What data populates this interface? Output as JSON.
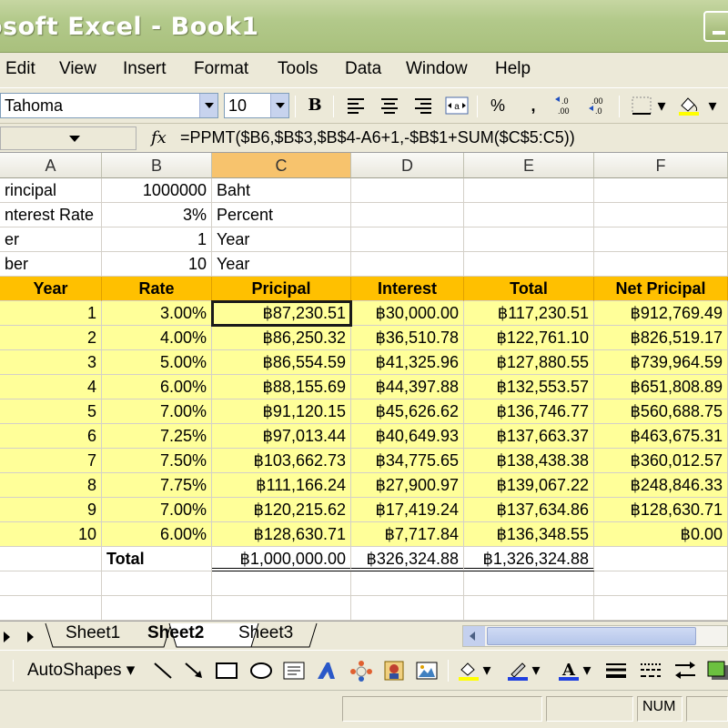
{
  "window": {
    "title": "osoft Excel - Book1"
  },
  "menu": [
    "Edit",
    "View",
    "Insert",
    "Format",
    "Tools",
    "Data",
    "Window",
    "Help"
  ],
  "format_toolbar": {
    "font_name": "Tahoma",
    "font_size": "10",
    "bold": "B",
    "percent": "%",
    "comma": ","
  },
  "formula_bar": {
    "fx": "fx",
    "formula": "=PPMT($B6,$B$3,$B$4-A6+1,-$B$1+SUM($C$5:C5))"
  },
  "columns": [
    "A",
    "B",
    "C",
    "D",
    "E",
    "F"
  ],
  "params": [
    [
      "rincipal",
      "1000000",
      "Baht"
    ],
    [
      "nterest Rate",
      "3%",
      "Percent"
    ],
    [
      "er",
      "1",
      "Year"
    ],
    [
      "ber",
      "10",
      "Year"
    ]
  ],
  "table": {
    "headers": [
      "Year",
      "Rate",
      "Pricipal",
      "Interest",
      "Total",
      "Net Pricipal"
    ],
    "rows": [
      [
        "1",
        "3.00%",
        "฿87,230.51",
        "฿30,000.00",
        "฿117,230.51",
        "฿912,769.49"
      ],
      [
        "2",
        "4.00%",
        "฿86,250.32",
        "฿36,510.78",
        "฿122,761.10",
        "฿826,519.17"
      ],
      [
        "3",
        "5.00%",
        "฿86,554.59",
        "฿41,325.96",
        "฿127,880.55",
        "฿739,964.59"
      ],
      [
        "4",
        "6.00%",
        "฿88,155.69",
        "฿44,397.88",
        "฿132,553.57",
        "฿651,808.89"
      ],
      [
        "5",
        "7.00%",
        "฿91,120.15",
        "฿45,626.62",
        "฿136,746.77",
        "฿560,688.75"
      ],
      [
        "6",
        "7.25%",
        "฿97,013.44",
        "฿40,649.93",
        "฿137,663.37",
        "฿463,675.31"
      ],
      [
        "7",
        "7.50%",
        "฿103,662.73",
        "฿34,775.65",
        "฿138,438.38",
        "฿360,012.57"
      ],
      [
        "8",
        "7.75%",
        "฿111,166.24",
        "฿27,900.97",
        "฿139,067.22",
        "฿248,846.33"
      ],
      [
        "9",
        "7.00%",
        "฿120,215.62",
        "฿17,419.24",
        "฿137,634.86",
        "฿128,630.71"
      ],
      [
        "10",
        "6.00%",
        "฿128,630.71",
        "฿7,717.84",
        "฿136,348.55",
        "฿0.00"
      ]
    ],
    "total": [
      "Total",
      "฿1,000,000.00",
      "฿326,324.88",
      "฿1,326,324.88"
    ]
  },
  "sheets": [
    "Sheet1",
    "Sheet2",
    "Sheet3"
  ],
  "active_sheet": "Sheet2",
  "drawing_toolbar": {
    "autoshapes": "AutoShapes ▾"
  },
  "status": {
    "num": "NUM"
  },
  "colors": {
    "header_fill": "#ffc000",
    "data_fill": "#ffff99",
    "selected_col": "#f7c36d"
  }
}
